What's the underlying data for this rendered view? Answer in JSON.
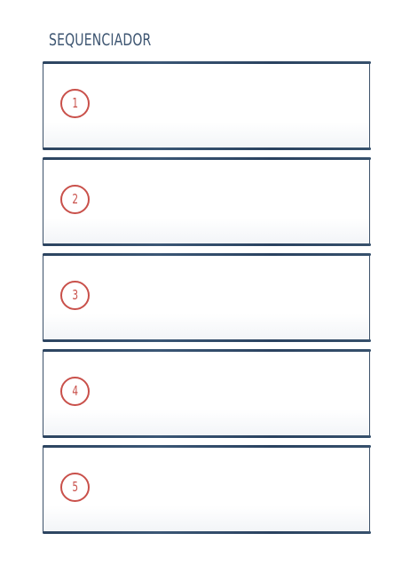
{
  "title": "SEQUENCIADOR",
  "steps": [
    {
      "number": "1"
    },
    {
      "number": "2"
    },
    {
      "number": "3"
    },
    {
      "number": "4"
    },
    {
      "number": "5"
    }
  ],
  "colors": {
    "title": "#3e5672",
    "frame": "#2c4460",
    "number": "#c9504a"
  }
}
